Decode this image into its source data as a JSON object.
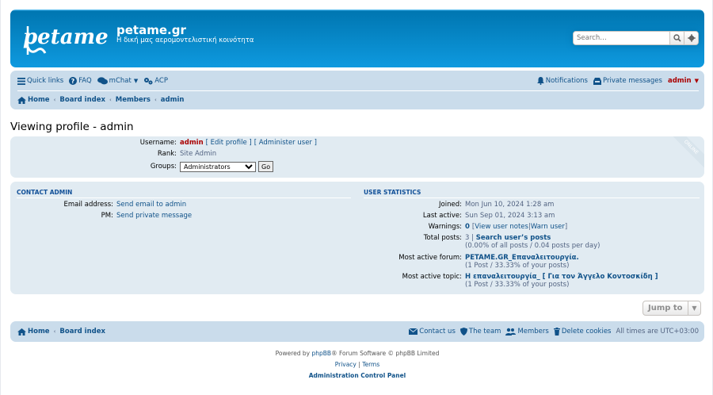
{
  "header": {
    "logo_text": "petame.gr",
    "site_title": "petame.gr",
    "site_desc": "Η δική μας αερομοντελιστική κοινότητα",
    "search_placeholder": "Search…"
  },
  "navbar": {
    "quick_links": "Quick links",
    "faq": "FAQ",
    "mchat": "mChat",
    "acp": "ACP",
    "notifications": "Notifications",
    "private_messages": "Private messages",
    "user": "admin",
    "breadcrumbs": [
      "Home",
      "Board index",
      "Members",
      "admin"
    ]
  },
  "page_title": "Viewing profile - admin",
  "profile": {
    "username_label": "Username:",
    "username": "admin",
    "edit_profile": "[ Edit profile ]",
    "administer_user": "[ Administer user ]",
    "rank_label": "Rank:",
    "rank": "Site Admin",
    "groups_label": "Groups:",
    "group_selected": "Administrators",
    "go_label": "Go",
    "online_badge": "ONLINE"
  },
  "contact": {
    "heading": "CONTACT ADMIN",
    "email_label": "Email address:",
    "email_value": "Send email to admin",
    "pm_label": "PM:",
    "pm_value": "Send private message"
  },
  "stats": {
    "heading": "USER STATISTICS",
    "joined_label": "Joined:",
    "joined": "Mon Jun 10, 2024 1:28 am",
    "last_active_label": "Last active:",
    "last_active": "Sun Sep 01, 2024 3:13 am",
    "warnings_label": "Warnings:",
    "warnings_count": "0",
    "view_user_notes": "View user notes",
    "warn_user": "Warn user",
    "total_posts_label": "Total posts:",
    "total_posts": "3",
    "search_posts": "Search user’s posts",
    "total_posts_detail": "(0.00% of all posts / 0.04 posts per day)",
    "active_forum_label": "Most active forum:",
    "active_forum": "PETAME.GR_Επαναλειτουργία.",
    "active_forum_detail": "(1 Post / 33.33% of your posts)",
    "active_topic_label": "Most active topic:",
    "active_topic": "Η επαναλειτουργία_ [ Για τον Άγγελο Κοντοσκίδη ]",
    "active_topic_detail": "(1 Post / 33.33% of your posts)"
  },
  "jump_to": "Jump to",
  "footer_nav": {
    "home": "Home",
    "board_index": "Board index",
    "contact_us": "Contact us",
    "the_team": "The team",
    "members": "Members",
    "delete_cookies": "Delete cookies",
    "timezone": "All times are UTC+03:00"
  },
  "footer": {
    "powered_prefix": "Powered by ",
    "phpbb": "phpBB",
    "powered_suffix": "® Forum Software © phpBB Limited",
    "privacy": "Privacy",
    "terms": "Terms",
    "acp_link": "Administration Control Panel"
  },
  "colors": {
    "header_blue": "#12a3eb",
    "navbar_bg": "#cadceb",
    "panel_bg": "#e1ebf2",
    "link": "#105289",
    "admin_red": "#aa0000"
  }
}
